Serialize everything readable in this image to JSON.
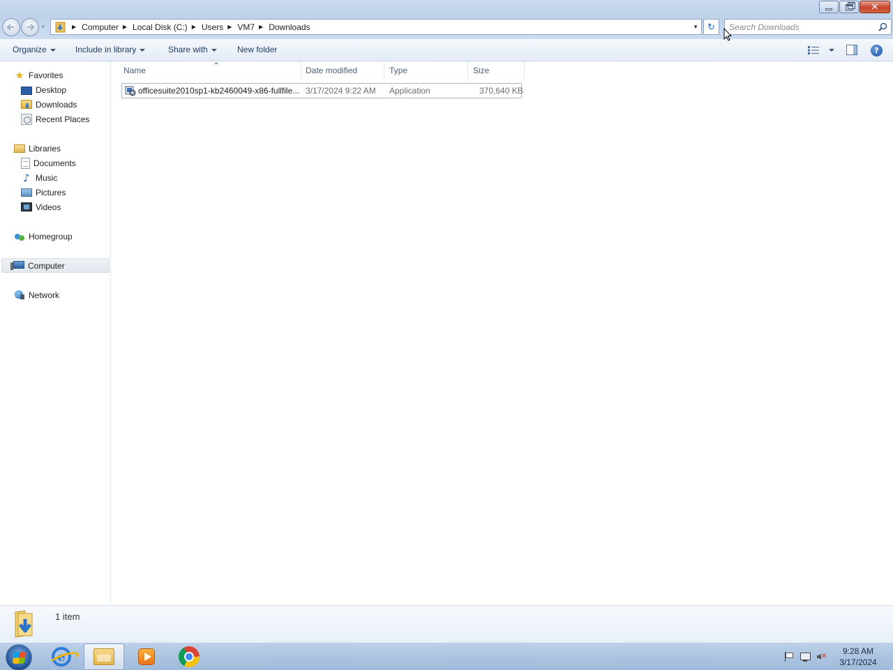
{
  "window": {
    "close_glyph": "✕"
  },
  "address": {
    "crumbs": [
      "Computer",
      "Local Disk (C:)",
      "Users",
      "VM7",
      "Downloads"
    ],
    "search_placeholder": "Search Downloads"
  },
  "toolbar": {
    "organize": "Organize",
    "include_in_library": "Include in library",
    "share_with": "Share with",
    "new_folder": "New folder",
    "help_glyph": "?"
  },
  "nav": {
    "favorites": "Favorites",
    "desktop": "Desktop",
    "downloads": "Downloads",
    "recent_places": "Recent Places",
    "libraries": "Libraries",
    "documents": "Documents",
    "music": "Music",
    "pictures": "Pictures",
    "videos": "Videos",
    "homegroup": "Homegroup",
    "computer": "Computer",
    "network": "Network"
  },
  "columns": {
    "name": "Name",
    "date_modified": "Date modified",
    "type": "Type",
    "size": "Size"
  },
  "files": [
    {
      "name": "officesuite2010sp1-kb2460049-x86-fullfile...",
      "date_modified": "3/17/2024 9:22 AM",
      "type": "Application",
      "size": "370,640 KB"
    }
  ],
  "details": {
    "item_count": "1 item"
  },
  "taskbar": {
    "time": "9:28 AM",
    "date": "3/17/2024"
  },
  "icons": {
    "star": "★",
    "music_note": "♪",
    "refresh": "↻",
    "ie": "e"
  }
}
